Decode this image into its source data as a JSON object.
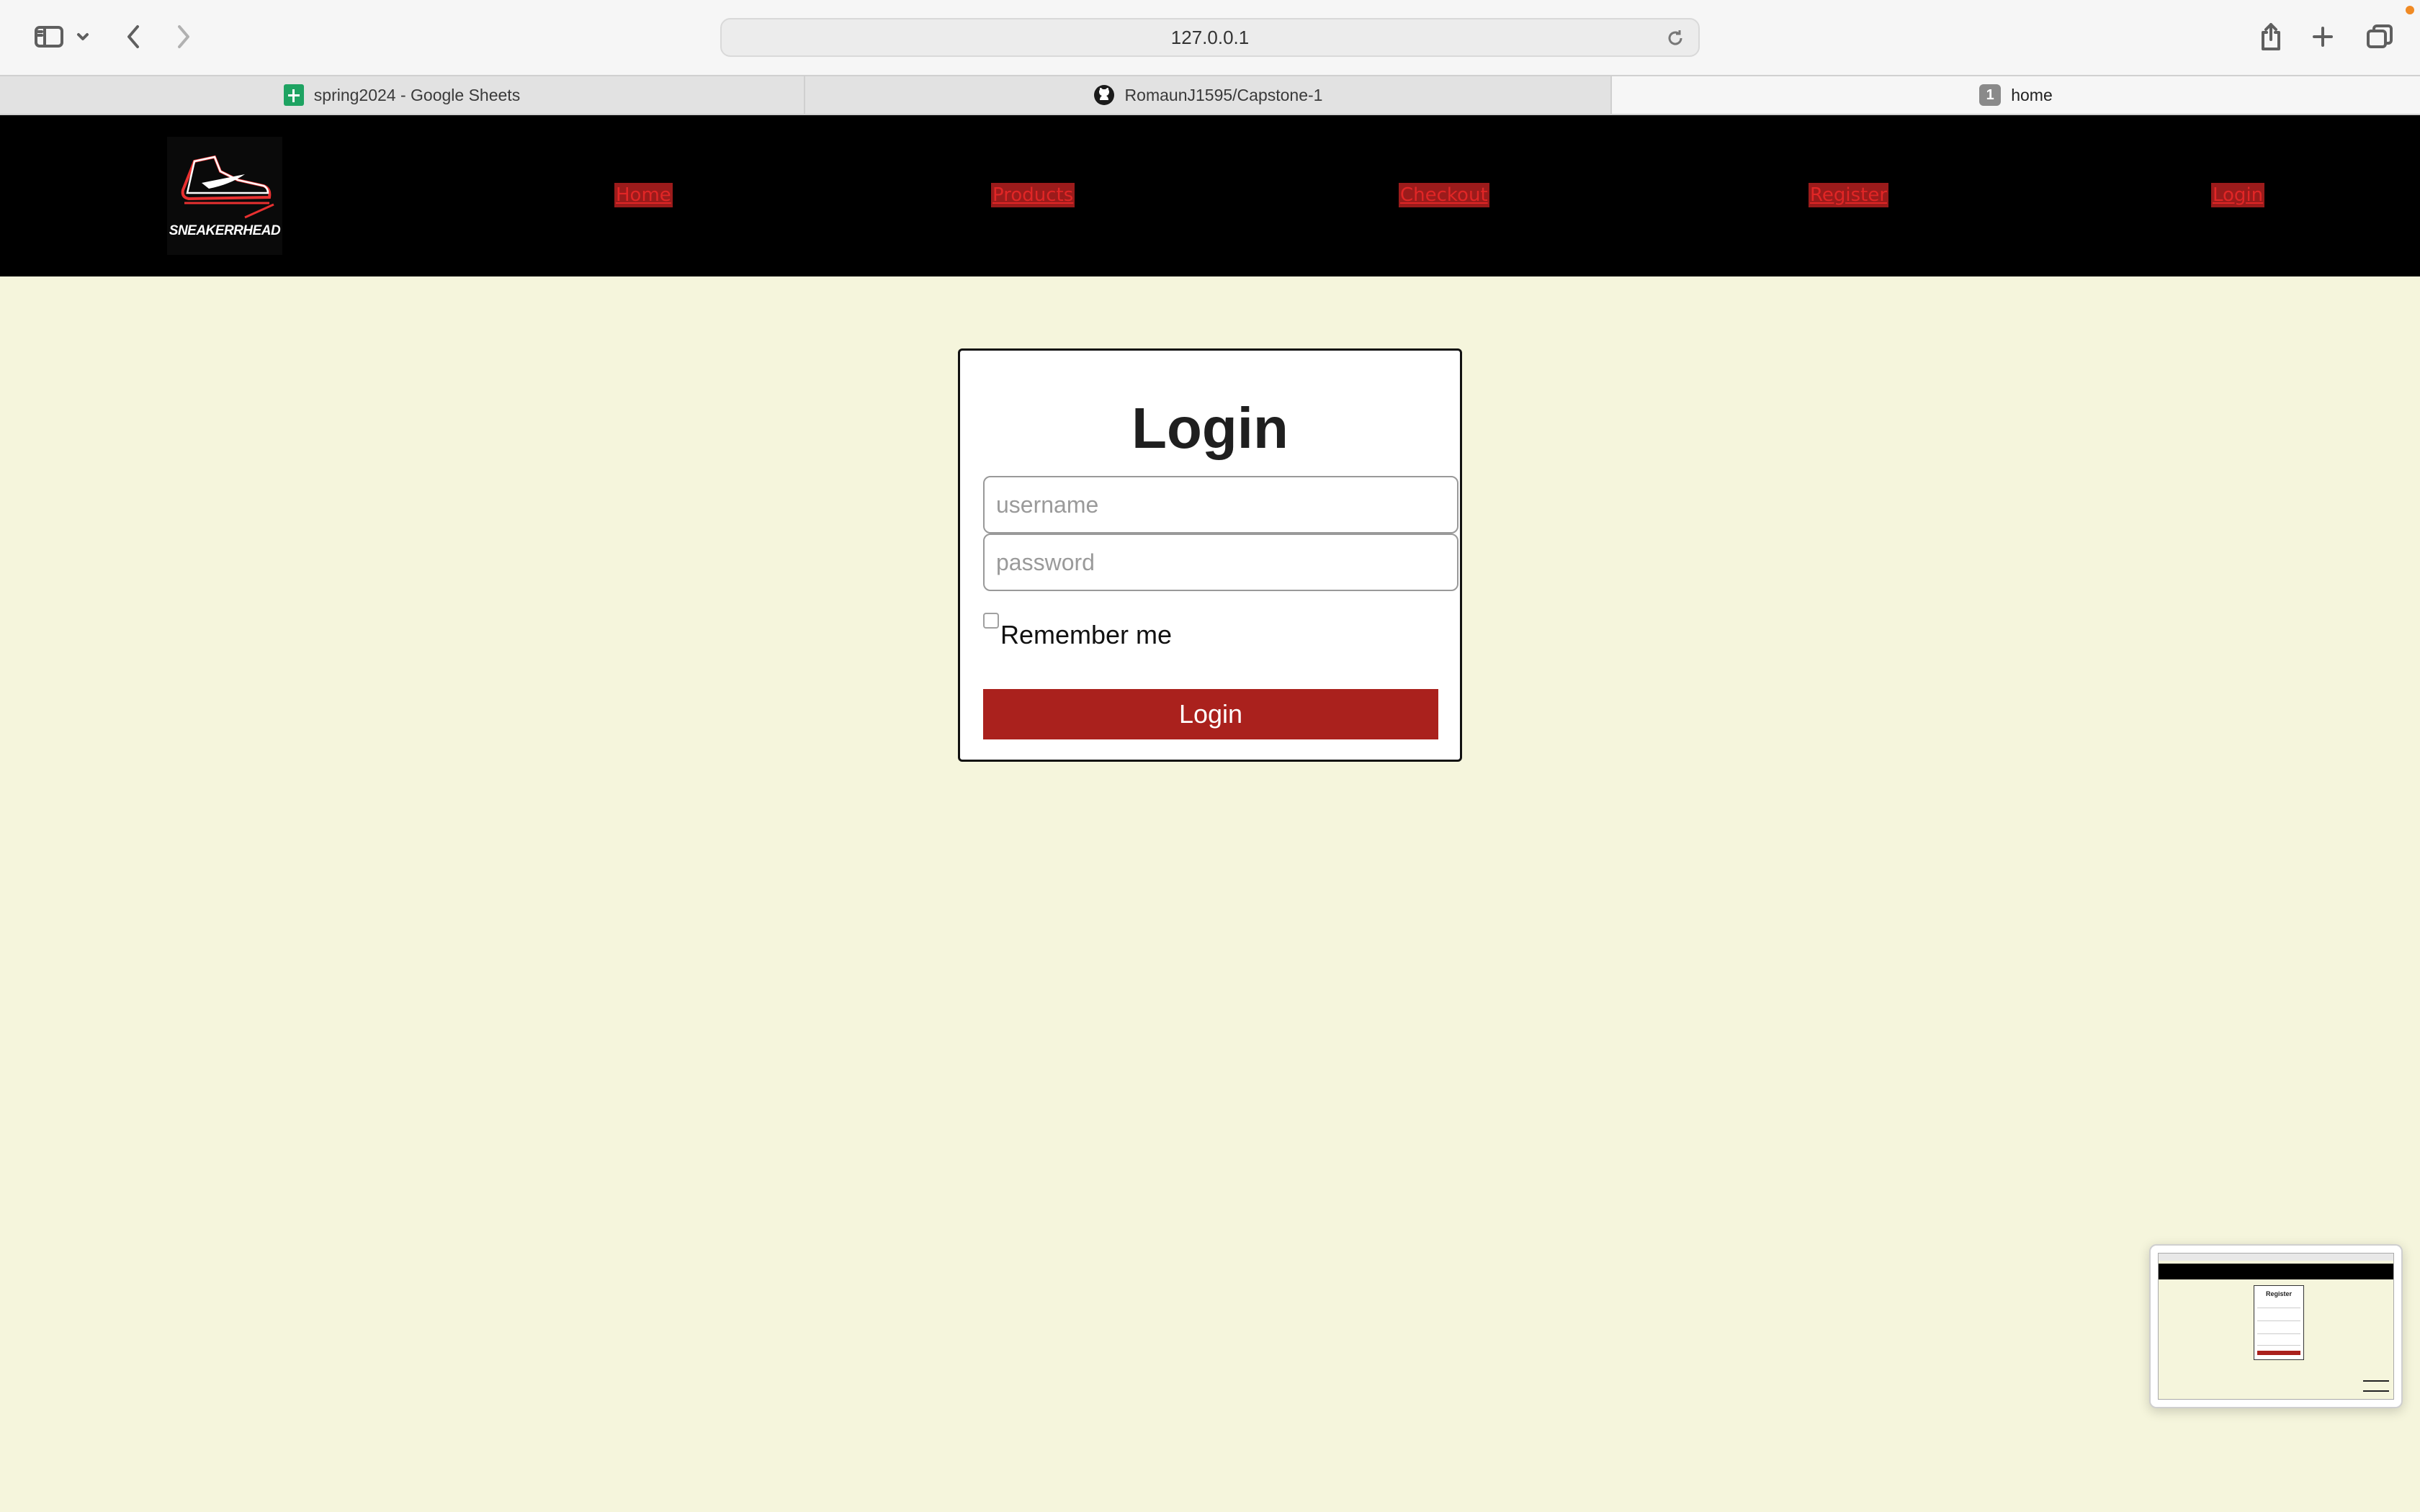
{
  "browser": {
    "url": "127.0.0.1",
    "tabs": [
      {
        "label": "spring2024 - Google Sheets",
        "icon": "google-sheets-icon"
      },
      {
        "label": "RomaunJ1595/Capstone-1",
        "icon": "github-icon"
      },
      {
        "label": "home",
        "icon": "tab-badge",
        "badge": "1"
      }
    ]
  },
  "site": {
    "logo_text": "SNEAKERRHEAD",
    "nav": [
      "Home",
      "Products",
      "Checkout",
      "Register",
      "Login"
    ]
  },
  "login_form": {
    "title": "Login",
    "username_placeholder": "username",
    "password_placeholder": "password",
    "remember_label": "Remember me",
    "submit_label": "Login"
  },
  "preview": {
    "title": "Register"
  },
  "colors": {
    "page_bg": "#f5f5dc",
    "nav_bg": "#000000",
    "accent_red": "#aa211d",
    "nav_link": "#e12626"
  }
}
